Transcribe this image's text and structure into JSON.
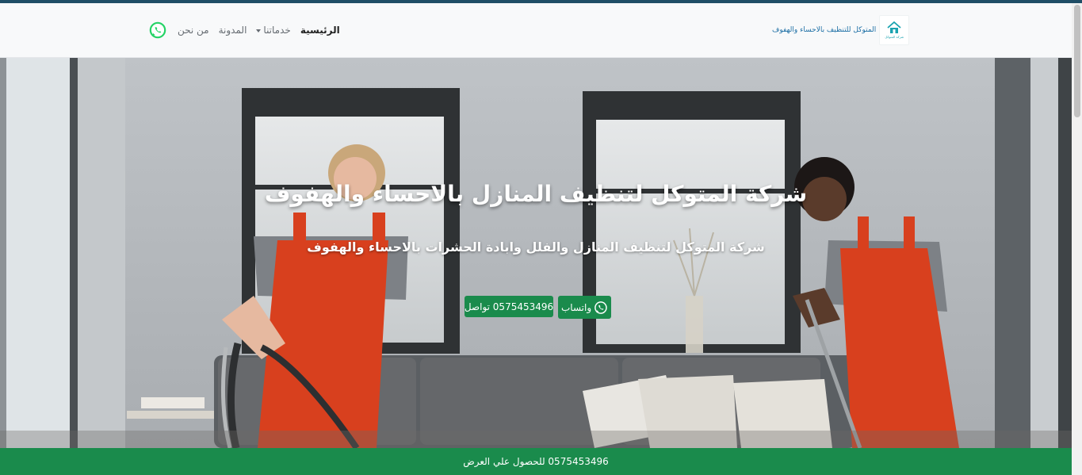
{
  "brand": {
    "name": "المتوكل للتنظيف بالاحساء والهفوف",
    "logo_caption": "شركة المتوكل",
    "logo_icon": "house-logo-icon"
  },
  "nav": {
    "items": [
      {
        "label": "الرئيسية",
        "active": true
      },
      {
        "label": "خدماتنا",
        "dropdown": true
      },
      {
        "label": "المدونة"
      },
      {
        "label": "من نحن"
      }
    ],
    "whatsapp_icon": "whatsapp-icon"
  },
  "hero": {
    "title": "شركة المتوكل لتنظيف المنازل بالاحساء والهفوف",
    "subtitle": "شركة المتوكل لتنظيف المنازل والفلل وابادة الحشرات بالاحساء والهفوف",
    "whatsapp_button": "واتساب",
    "call_button": "0575453496  تواصل"
  },
  "footer": {
    "offer_text": "0575453496 للحصول علي العرض"
  },
  "colors": {
    "primary_green": "#1a8b4c",
    "top_stripe": "#1f4e66",
    "brand_text": "#1d6fa5"
  }
}
